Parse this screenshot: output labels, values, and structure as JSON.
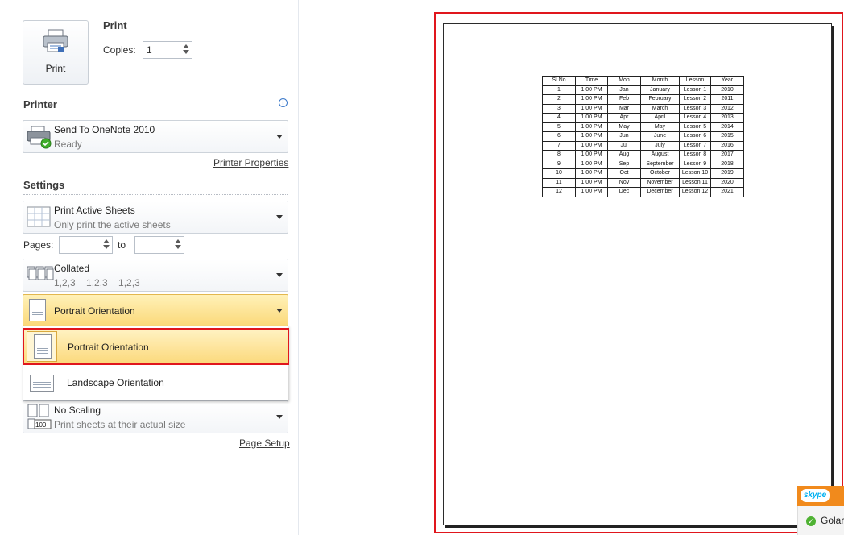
{
  "print_section": {
    "big_button_label": "Print",
    "title": "Print",
    "copies_label": "Copies:",
    "copies_value": "1"
  },
  "printer": {
    "title": "Printer",
    "info_icon": "info-icon",
    "name": "Send To OneNote 2010",
    "status": "Ready",
    "properties_link": "Printer Properties"
  },
  "settings": {
    "title": "Settings",
    "sheets_main": "Print Active Sheets",
    "sheets_sub": "Only print the active sheets",
    "pages_label": "Pages:",
    "pages_from": "",
    "pages_to_label": "to",
    "pages_to": "",
    "collated_main": "Collated",
    "collated_sub": "1,2,3    1,2,3    1,2,3",
    "orientation_selected": "Portrait Orientation",
    "orientation_options": [
      "Portrait Orientation",
      "Landscape Orientation"
    ],
    "scaling_main": "No Scaling",
    "scaling_sub": "Print sheets at their actual size",
    "scaling_badge": "100",
    "page_setup_link": "Page Setup"
  },
  "preview": {
    "headers": [
      "Sl No",
      "Time",
      "Mon",
      "Month",
      "Lesson",
      "Year"
    ],
    "rows": [
      [
        "1",
        "1.00 PM",
        "Jan",
        "January",
        "Lesson 1",
        "2010"
      ],
      [
        "2",
        "1.00 PM",
        "Feb",
        "February",
        "Lesson 2",
        "2011"
      ],
      [
        "3",
        "1.00 PM",
        "Mar",
        "March",
        "Lesson 3",
        "2012"
      ],
      [
        "4",
        "1.00 PM",
        "Apr",
        "April",
        "Lesson 4",
        "2013"
      ],
      [
        "5",
        "1.00 PM",
        "May",
        "May",
        "Lesson 5",
        "2014"
      ],
      [
        "6",
        "1.00 PM",
        "Jun",
        "June",
        "Lesson 6",
        "2015"
      ],
      [
        "7",
        "1.00 PM",
        "Jul",
        "July",
        "Lesson 7",
        "2016"
      ],
      [
        "8",
        "1.00 PM",
        "Aug",
        "August",
        "Lesson 8",
        "2017"
      ],
      [
        "9",
        "1.00 PM",
        "Sep",
        "September",
        "Lesson 9",
        "2018"
      ],
      [
        "10",
        "1.00 PM",
        "Oct",
        "October",
        "Lesson 10",
        "2019"
      ],
      [
        "11",
        "1.00 PM",
        "Nov",
        "November",
        "Lesson 11",
        "2020"
      ],
      [
        "12",
        "1.00 PM",
        "Dec",
        "December",
        "Lesson 12",
        "2021"
      ]
    ]
  },
  "skype": {
    "logo": "skype",
    "contact": "Golar"
  },
  "colors": {
    "highlight_red": "#e0161d",
    "selected_fill": "#fde58f",
    "skype_orange": "#f18a1c"
  }
}
